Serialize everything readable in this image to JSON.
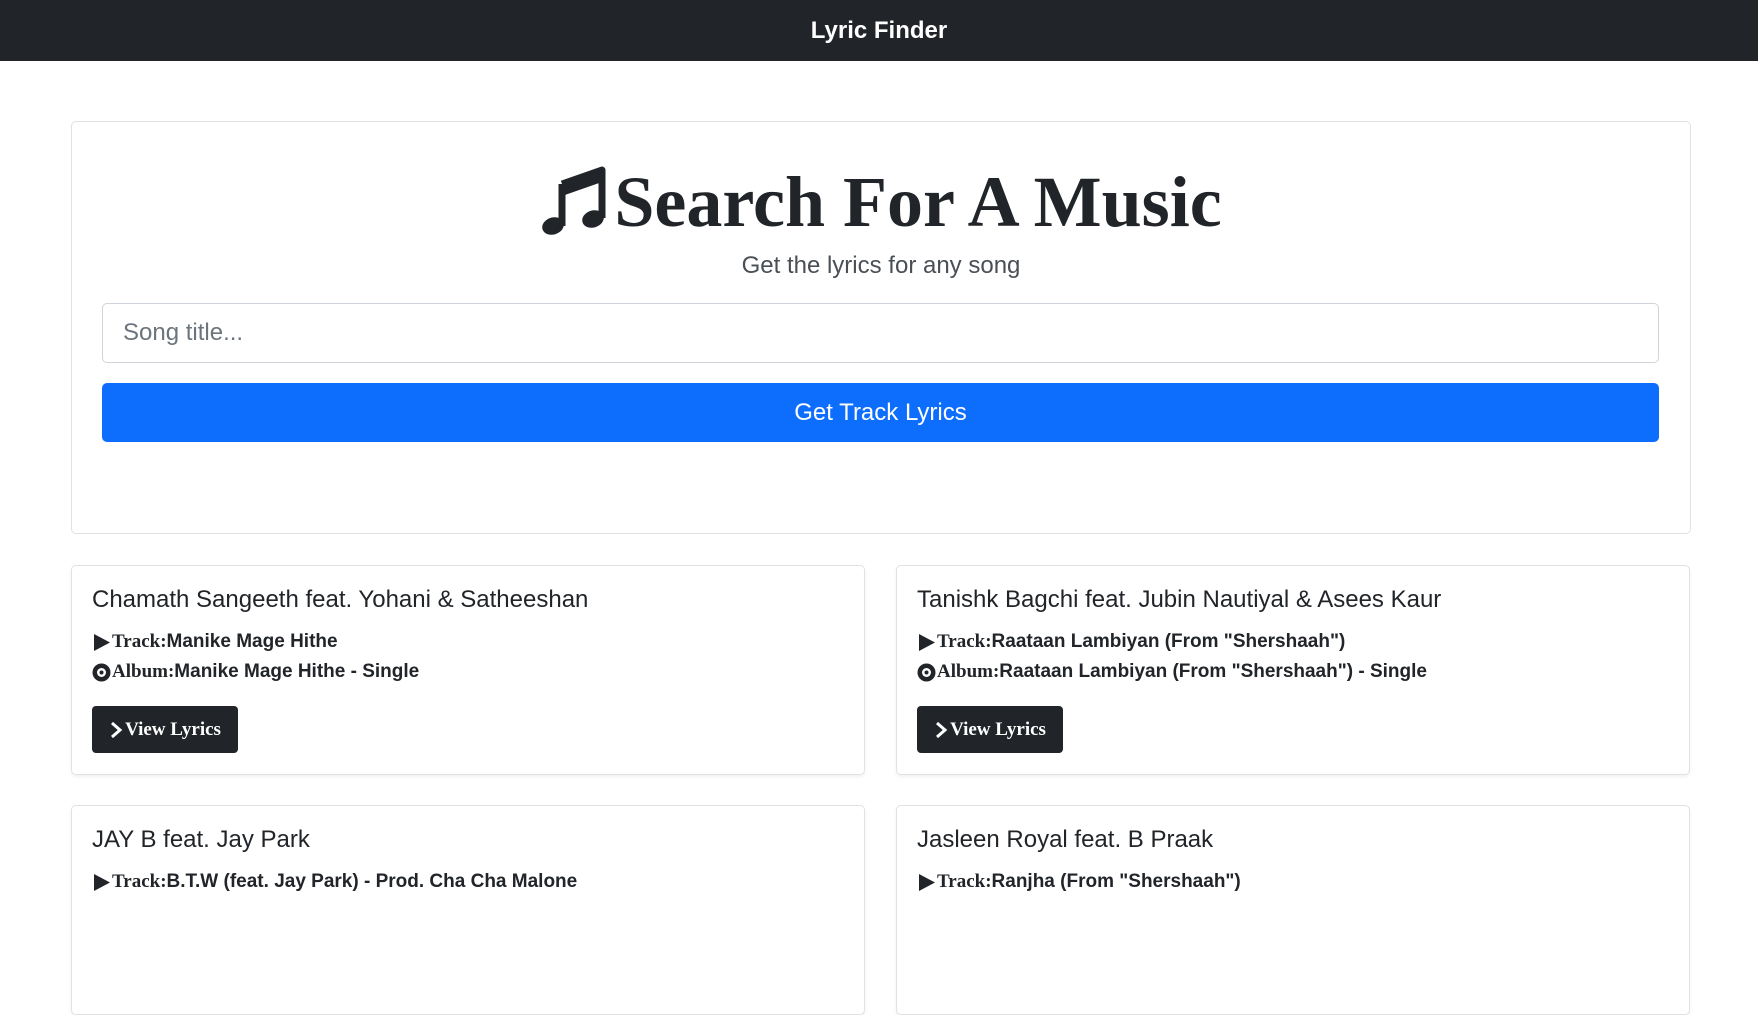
{
  "navbar": {
    "brand": "Lyric Finder"
  },
  "search": {
    "title": "Search For A Music",
    "subtitle": "Get the lyrics for any song",
    "placeholder": "Song title...",
    "button_label": "Get Track Lyrics",
    "icon": "music-note-icon"
  },
  "labels": {
    "track": "Track:",
    "album": "Album:",
    "view_lyrics": "View Lyrics"
  },
  "icons": {
    "track": "play-icon",
    "album": "disc-icon",
    "view": "chevron-right-icon"
  },
  "colors": {
    "navbar": "#212529",
    "primary": "#0d6efd",
    "dark_button": "#212529"
  },
  "results": [
    {
      "artist": "Chamath Sangeeth feat. Yohani & Satheeshan",
      "track": "Manike Mage Hithe",
      "album": "Manike Mage Hithe - Single"
    },
    {
      "artist": "Tanishk Bagchi feat. Jubin Nautiyal & Asees Kaur",
      "track": "Raataan Lambiyan (From \"Shershaah\")",
      "album": "Raataan Lambiyan (From \"Shershaah\") - Single"
    },
    {
      "artist": "JAY B feat. Jay Park",
      "track": "B.T.W (feat. Jay Park) - Prod. Cha Cha Malone",
      "album": ""
    },
    {
      "artist": "Jasleen Royal feat. B Praak",
      "track": "Ranjha (From \"Shershaah\")",
      "album": ""
    }
  ]
}
